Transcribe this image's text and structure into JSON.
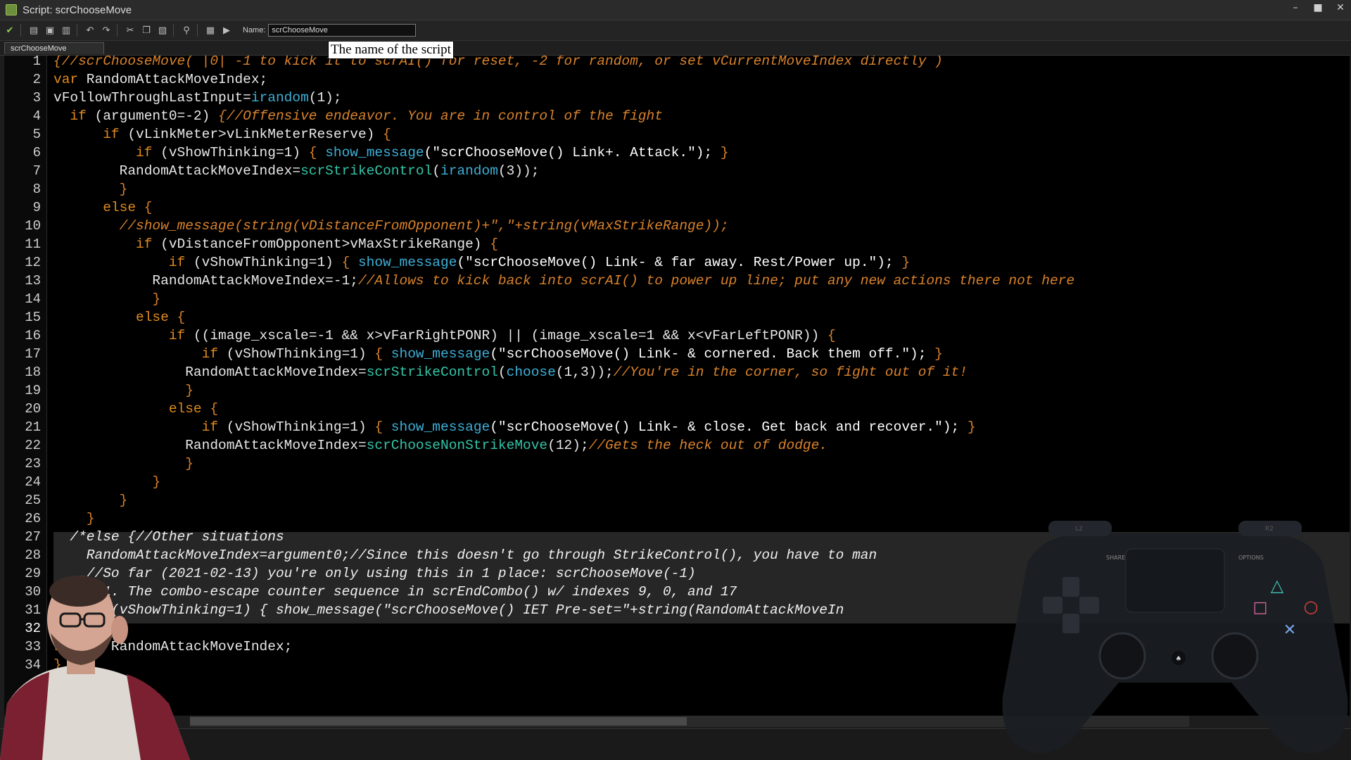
{
  "window": {
    "title": "Script: scrChooseMove",
    "controls": [
      "–",
      "■",
      "✕"
    ]
  },
  "toolbar": {
    "buttons": [
      {
        "icon": "check-icon",
        "glyph": "✔"
      },
      {
        "icon": "open-folder-icon",
        "glyph": "▤"
      },
      {
        "icon": "save-icon",
        "glyph": "▣"
      },
      {
        "icon": "print-icon",
        "glyph": "▥"
      },
      {
        "icon": "undo-icon",
        "glyph": "↶"
      },
      {
        "icon": "redo-icon",
        "glyph": "↷"
      },
      {
        "icon": "cut-icon",
        "glyph": "✂"
      },
      {
        "icon": "copy-icon",
        "glyph": "❐"
      },
      {
        "icon": "paste-icon",
        "glyph": "▧"
      },
      {
        "icon": "search-icon",
        "glyph": "⚲"
      },
      {
        "icon": "goto-icon",
        "glyph": "▦"
      },
      {
        "icon": "run-icon",
        "glyph": "▶"
      }
    ],
    "name_label": "Name:",
    "name_value": "scrChooseMove",
    "tooltip": "The name of the script"
  },
  "tabs": [
    {
      "label": "scrChooseMove"
    }
  ],
  "editor": {
    "current_line": "32",
    "lines": [
      {
        "n": "1",
        "segs": [
          [
            "cm",
            "{//scrChooseMove( |0| -1 to kick it to scrAI() for reset, -2 for random, or set vCurrentMoveIndex directly )"
          ]
        ]
      },
      {
        "n": "2",
        "segs": [
          [
            "kw",
            "var"
          ],
          [
            "id",
            " RandomAttackMoveIndex;"
          ]
        ]
      },
      {
        "n": "3",
        "segs": [
          [
            "id",
            "vFollowThroughLastInput="
          ],
          [
            "fn",
            "irandom"
          ],
          [
            "id",
            "(1);"
          ]
        ]
      },
      {
        "n": "4",
        "segs": [
          [
            "id",
            "  "
          ],
          [
            "kw",
            "if"
          ],
          [
            "id",
            " (argument0=-2) "
          ],
          [
            "cm",
            "{//Offensive endeavor. You are in control of the fight"
          ]
        ]
      },
      {
        "n": "5",
        "segs": [
          [
            "id",
            "      "
          ],
          [
            "kw",
            "if"
          ],
          [
            "id",
            " (vLinkMeter>vLinkMeterReserve) "
          ],
          [
            "br",
            "{"
          ]
        ]
      },
      {
        "n": "6",
        "segs": [
          [
            "id",
            "          "
          ],
          [
            "kw",
            "if"
          ],
          [
            "id",
            " (vShowThinking=1) "
          ],
          [
            "br",
            "{ "
          ],
          [
            "fn",
            "show_message"
          ],
          [
            "str",
            "(\"scrChooseMove() Link+. Attack.\"); "
          ],
          [
            "br",
            "}"
          ]
        ]
      },
      {
        "n": "7",
        "segs": [
          [
            "id",
            "        RandomAttackMoveIndex="
          ],
          [
            "sfn",
            "scrStrikeControl"
          ],
          [
            "id",
            "("
          ],
          [
            "fn",
            "irandom"
          ],
          [
            "id",
            "(3));"
          ]
        ]
      },
      {
        "n": "8",
        "segs": [
          [
            "id",
            "        "
          ],
          [
            "br",
            "}"
          ]
        ]
      },
      {
        "n": "9",
        "segs": [
          [
            "id",
            "      "
          ],
          [
            "kw",
            "else"
          ],
          [
            "br",
            " {"
          ]
        ]
      },
      {
        "n": "10",
        "segs": [
          [
            "id",
            "        "
          ],
          [
            "cm",
            "//show_message(string(vDistanceFromOpponent)+\",\"+string(vMaxStrikeRange));"
          ]
        ]
      },
      {
        "n": "11",
        "segs": [
          [
            "id",
            "          "
          ],
          [
            "kw",
            "if"
          ],
          [
            "id",
            " (vDistanceFromOpponent>vMaxStrikeRange) "
          ],
          [
            "br",
            "{"
          ]
        ]
      },
      {
        "n": "12",
        "segs": [
          [
            "id",
            "              "
          ],
          [
            "kw",
            "if"
          ],
          [
            "id",
            " (vShowThinking=1) "
          ],
          [
            "br",
            "{ "
          ],
          [
            "fn",
            "show_message"
          ],
          [
            "str",
            "(\"scrChooseMove() Link- & far away. Rest/Power up.\"); "
          ],
          [
            "br",
            "}"
          ]
        ]
      },
      {
        "n": "13",
        "segs": [
          [
            "id",
            "            RandomAttackMoveIndex=-1;"
          ],
          [
            "cm",
            "//Allows to kick back into scrAI() to power up line; put any new actions there not here"
          ]
        ]
      },
      {
        "n": "14",
        "segs": [
          [
            "id",
            "            "
          ],
          [
            "br",
            "}"
          ]
        ]
      },
      {
        "n": "15",
        "segs": [
          [
            "id",
            "          "
          ],
          [
            "kw",
            "else"
          ],
          [
            "br",
            " {"
          ]
        ]
      },
      {
        "n": "16",
        "segs": [
          [
            "id",
            "              "
          ],
          [
            "kw",
            "if"
          ],
          [
            "id",
            " ((image_xscale=-1 && x>vFarRightPONR) || (image_xscale=1 && x<vFarLeftPONR)) "
          ],
          [
            "br",
            "{"
          ]
        ]
      },
      {
        "n": "17",
        "segs": [
          [
            "id",
            "                  "
          ],
          [
            "kw",
            "if"
          ],
          [
            "id",
            " (vShowThinking=1) "
          ],
          [
            "br",
            "{ "
          ],
          [
            "fn",
            "show_message"
          ],
          [
            "str",
            "(\"scrChooseMove() Link- & cornered. Back them off.\"); "
          ],
          [
            "br",
            "}"
          ]
        ]
      },
      {
        "n": "18",
        "segs": [
          [
            "id",
            "                RandomAttackMoveIndex="
          ],
          [
            "sfn",
            "scrStrikeControl"
          ],
          [
            "id",
            "("
          ],
          [
            "fn",
            "choose"
          ],
          [
            "id",
            "(1,3));"
          ],
          [
            "cm",
            "//You're in the corner, so fight out of it!"
          ]
        ]
      },
      {
        "n": "19",
        "segs": [
          [
            "id",
            "                "
          ],
          [
            "br",
            "}"
          ]
        ]
      },
      {
        "n": "20",
        "segs": [
          [
            "id",
            "              "
          ],
          [
            "kw",
            "else"
          ],
          [
            "br",
            " {"
          ]
        ]
      },
      {
        "n": "21",
        "segs": [
          [
            "id",
            "                  "
          ],
          [
            "kw",
            "if"
          ],
          [
            "id",
            " (vShowThinking=1) "
          ],
          [
            "br",
            "{ "
          ],
          [
            "fn",
            "show_message"
          ],
          [
            "str",
            "(\"scrChooseMove() Link- & close. Get back and recover.\"); "
          ],
          [
            "br",
            "}"
          ]
        ]
      },
      {
        "n": "22",
        "segs": [
          [
            "id",
            "                RandomAttackMoveIndex="
          ],
          [
            "sfn",
            "scrChooseNonStrikeMove"
          ],
          [
            "id",
            "(12);"
          ],
          [
            "cm",
            "//Gets the heck out of dodge."
          ]
        ]
      },
      {
        "n": "23",
        "segs": [
          [
            "id",
            "                "
          ],
          [
            "br",
            "}"
          ]
        ]
      },
      {
        "n": "24",
        "segs": [
          [
            "id",
            "            "
          ],
          [
            "br",
            "}"
          ]
        ]
      },
      {
        "n": "25",
        "segs": [
          [
            "id",
            "        "
          ],
          [
            "br",
            "}"
          ]
        ]
      },
      {
        "n": "26",
        "segs": [
          [
            "id",
            "    "
          ],
          [
            "br",
            "}"
          ]
        ]
      },
      {
        "n": "27",
        "segs": [
          [
            "gray",
            "  /*else {//Other situations"
          ]
        ]
      },
      {
        "n": "28",
        "segs": [
          [
            "gray",
            "    RandomAttackMoveIndex=argument0;//Since this doesn't go through StrikeControl(), you have to man"
          ]
        ]
      },
      {
        "n": "29",
        "segs": [
          [
            "gray",
            "    //So far (2021-02-13) you're only using this in 1 place: scrChooseMove(-1)"
          ]
        ]
      },
      {
        "n": "30",
        "segs": [
          [
            "gray",
            "    //1. The combo-escape counter sequence in scrEndCombo() w/ indexes 9, 0, and 17"
          ]
        ]
      },
      {
        "n": "31",
        "segs": [
          [
            "gray",
            "    if (vShowThinking=1) { show_message(\"scrChooseMove() IET Pre-set=\"+string(RandomAttackMoveIn"
          ]
        ]
      },
      {
        "n": "32",
        "segs": []
      },
      {
        "n": "33",
        "segs": [
          [
            "kw",
            "return"
          ],
          [
            "id",
            " RandomAttackMoveIndex;"
          ]
        ]
      },
      {
        "n": "34",
        "segs": [
          [
            "br",
            "}"
          ]
        ]
      }
    ]
  },
  "controller": {
    "share_label": "SHARE",
    "options_label": "OPTIONS",
    "l_label": "L2",
    "r_label": "R2"
  },
  "colors": {
    "keyword": "#e08a1e",
    "comment": "#d9822b",
    "builtin_fn": "#3db0d8",
    "script_fn": "#33c4a8",
    "background": "#000000"
  }
}
